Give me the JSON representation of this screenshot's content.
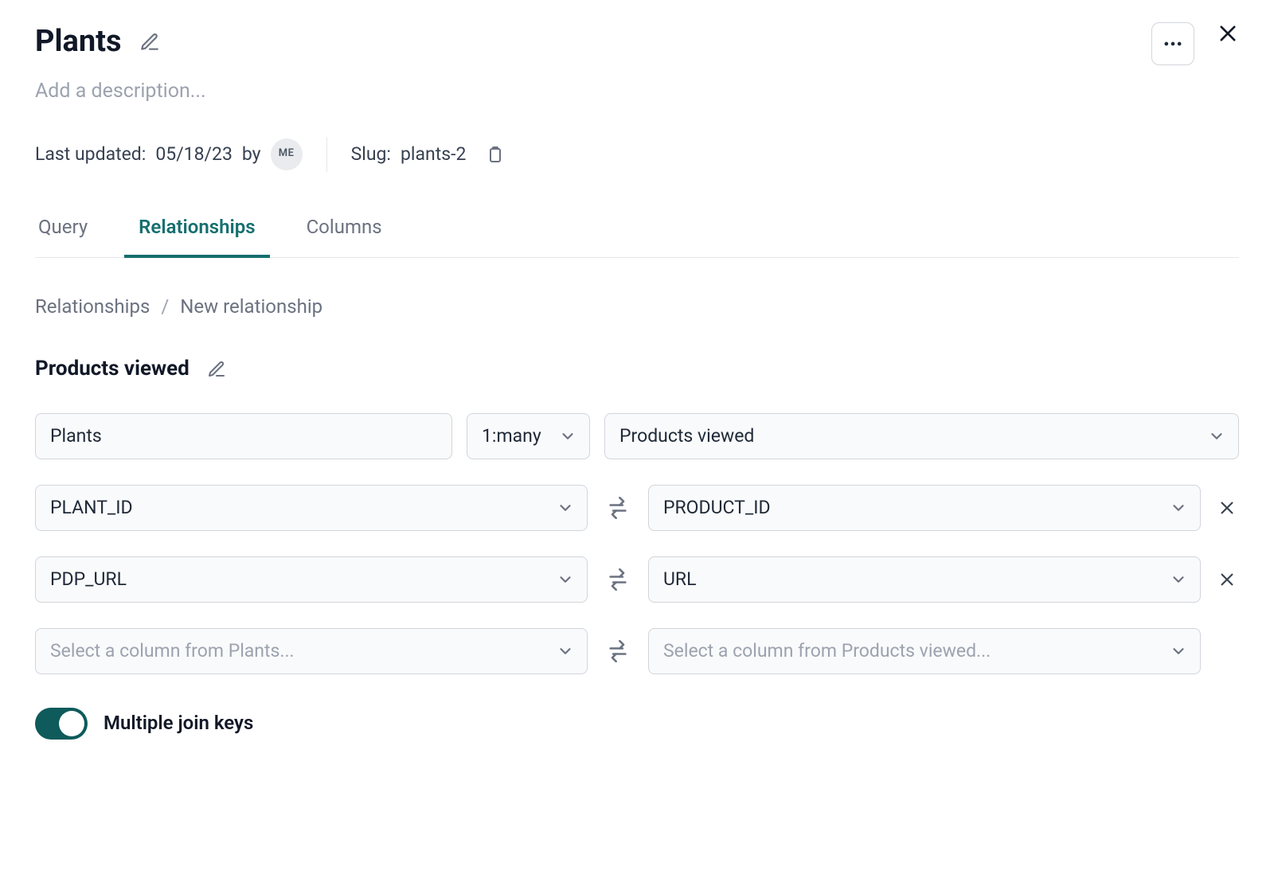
{
  "header": {
    "title": "Plants",
    "description_placeholder": "Add a description..."
  },
  "meta": {
    "last_updated_label": "Last updated:",
    "last_updated_date": "05/18/23",
    "by_label": "by",
    "user_initials": "ME",
    "slug_label": "Slug:",
    "slug_value": "plants-2"
  },
  "tabs": {
    "query": "Query",
    "relationships": "Relationships",
    "columns": "Columns",
    "active": "relationships"
  },
  "breadcrumb": {
    "root": "Relationships",
    "current": "New relationship"
  },
  "relationship": {
    "name": "Products viewed",
    "left_model": "Plants",
    "cardinality": "1:many",
    "right_model": "Products viewed",
    "join_rows": [
      {
        "left": "PLANT_ID",
        "right": "PRODUCT_ID",
        "removable": true
      },
      {
        "left": "PDP_URL",
        "right": "URL",
        "removable": true
      }
    ],
    "empty_row": {
      "left_placeholder": "Select a column from Plants...",
      "right_placeholder": "Select a column from Products viewed..."
    },
    "multiple_join_keys_label": "Multiple join keys",
    "multiple_join_keys_on": true
  }
}
